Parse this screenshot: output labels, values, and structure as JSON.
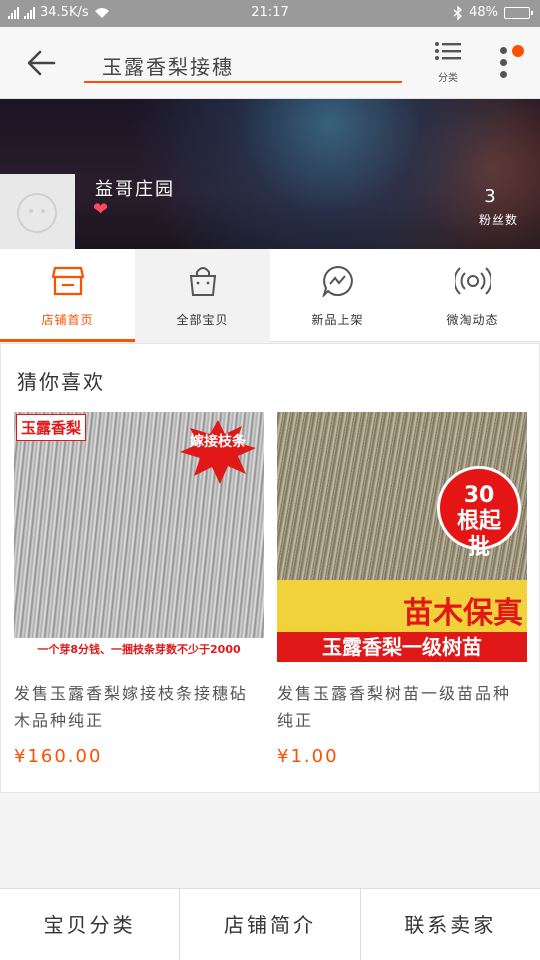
{
  "status_bar": {
    "speed": "34.5K/s",
    "time": "21:17",
    "battery_percent": "48%",
    "battery_level": 0.48
  },
  "search": {
    "value": "玉露香梨接穗"
  },
  "nav": {
    "category_label": "分类"
  },
  "shop": {
    "name": "益哥庄园",
    "fans_count": "3",
    "fans_label": "粉丝数"
  },
  "tabs": [
    {
      "label": "店铺首页",
      "icon": "store-icon",
      "active": true
    },
    {
      "label": "全部宝贝",
      "icon": "shopping-bag-icon",
      "active": false
    },
    {
      "label": "新品上架",
      "icon": "new-arrival-icon",
      "active": false
    },
    {
      "label": "微淘动态",
      "icon": "broadcast-icon",
      "active": false
    }
  ],
  "recommend": {
    "title": "猜你喜欢",
    "products": [
      {
        "title": "发售玉露香梨嫁接枝条接穗砧木品种纯正",
        "price": "¥160.00",
        "image_text_tag": "玉露香梨",
        "image_text_burst": "嫁接枝条",
        "image_text_bottom": "一个芽8分钱、一捆枝条芽数不少于2000"
      },
      {
        "title": "发售玉露香梨树苗一级苗品种纯正",
        "price": "¥1.00",
        "image_text_circle": "30根起批",
        "image_text_yellow": "苗木保真",
        "image_text_bottom": "玉露香梨一级树苗"
      }
    ]
  },
  "bottom_bar": {
    "items": [
      "宝贝分类",
      "店铺简介",
      "联系卖家"
    ]
  },
  "colors": {
    "accent": "#ff5000",
    "price": "#ff5000",
    "badge_red": "#e01818"
  }
}
